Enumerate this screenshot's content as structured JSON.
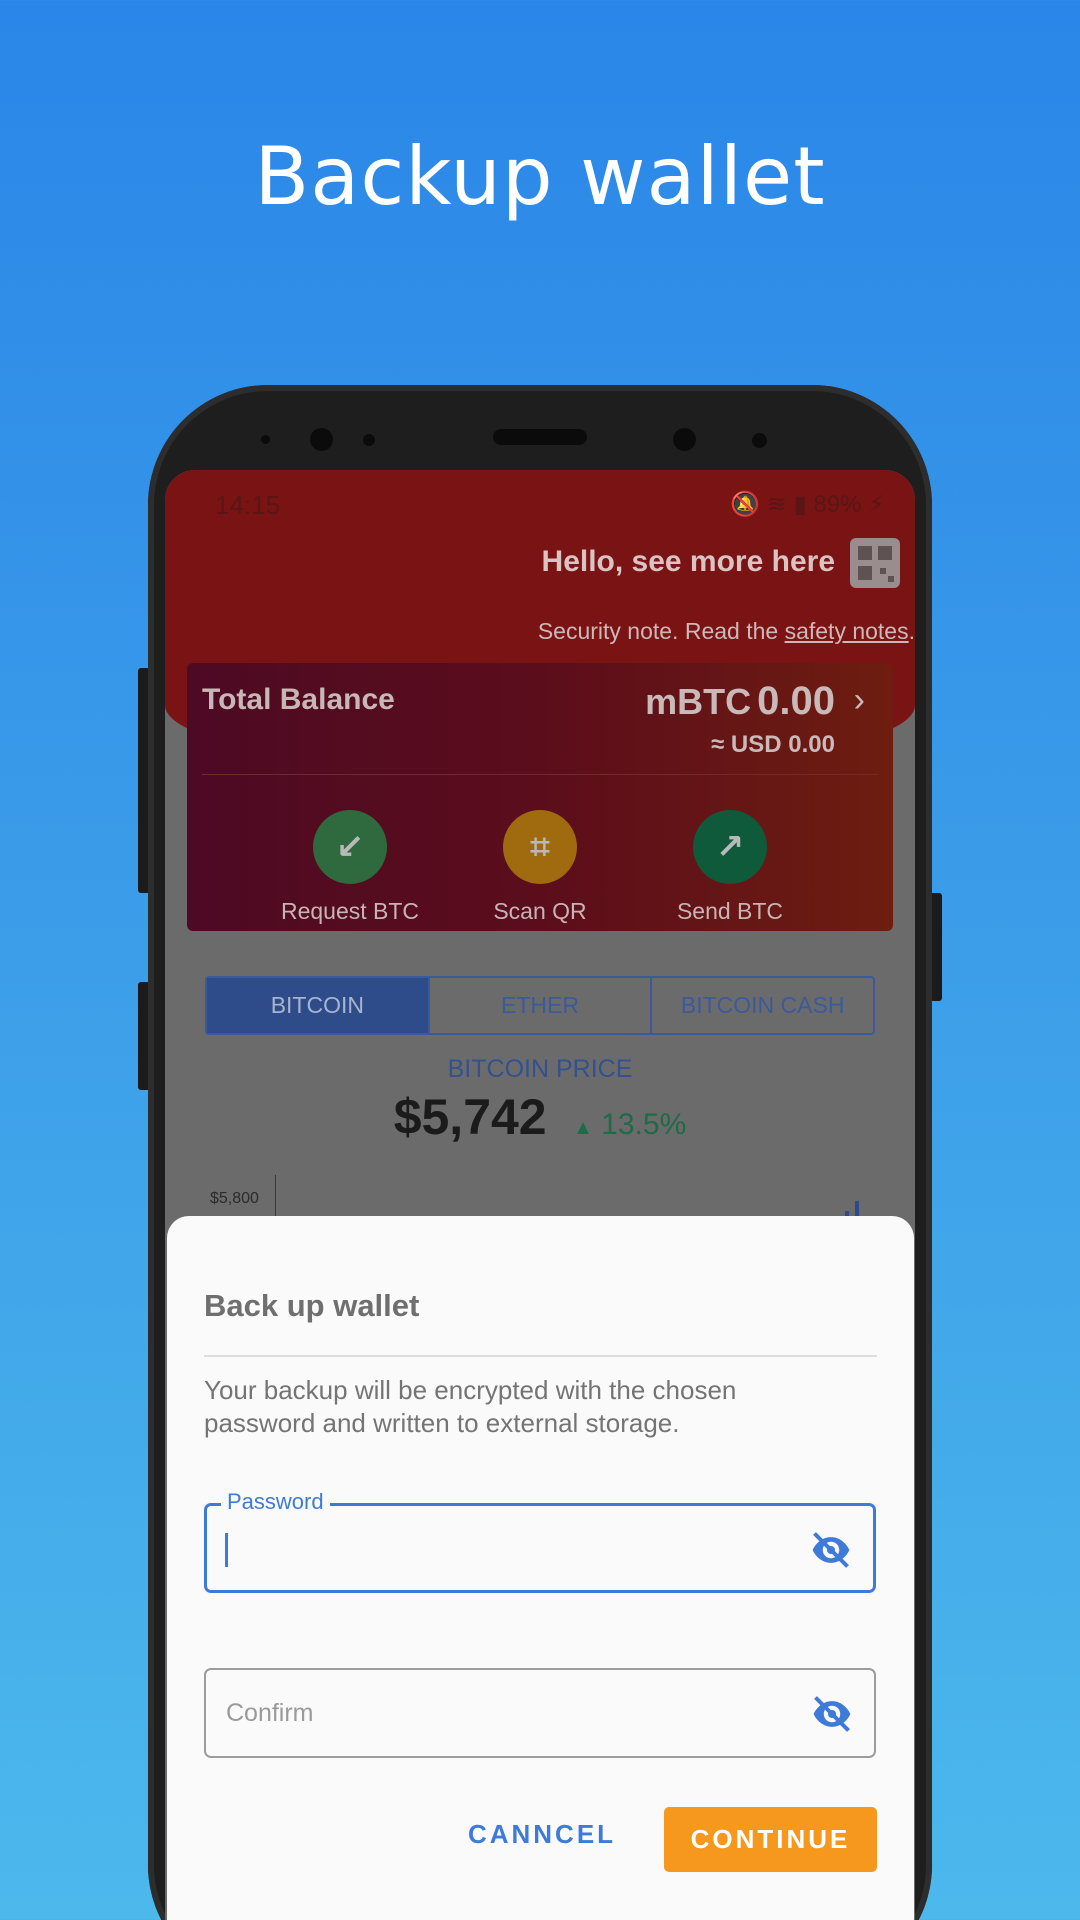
{
  "promo": {
    "title": "Backup wallet"
  },
  "status_bar": {
    "time": "14:15",
    "battery": "89%"
  },
  "header": {
    "greeting": "Hello, see more here",
    "security_prefix": "Security note. Read the ",
    "security_link": "safety notes",
    "security_suffix": "."
  },
  "balance": {
    "label": "Total Balance",
    "unit": "mBTC",
    "value": "0.00",
    "usd_prefix": "≈ USD",
    "usd_value": "0.00"
  },
  "actions": [
    {
      "label": "Request BTC",
      "icon": "arrow-down-left-icon",
      "color": "#2e6a3e"
    },
    {
      "label": "Scan QR",
      "icon": "qr-scan-icon",
      "color": "#a06a0e"
    },
    {
      "label": "Send BTC",
      "icon": "arrow-up-right-icon",
      "color": "#0e5a3b"
    }
  ],
  "tabs": [
    {
      "label": "BITCOIN",
      "active": true
    },
    {
      "label": "ETHER",
      "active": false
    },
    {
      "label": "BITCOIN CASH",
      "active": false
    }
  ],
  "price": {
    "label": "BITCOIN PRICE",
    "value": "$5,742",
    "change": "13.5%",
    "change_icon": "triangle-up-icon"
  },
  "chart": {
    "tick": "$5,800"
  },
  "dialog": {
    "title": "Back up wallet",
    "description": "Your backup will be encrypted with the chosen password and written to external storage.",
    "password_label": "Password",
    "confirm_placeholder": "Confirm",
    "cancel_label": "CANNCEL",
    "continue_label": "CONTINUE"
  },
  "colors": {
    "accent": "#3e7bd9",
    "continue": "#f6981d",
    "background_top": "#2a86e8",
    "background_bottom": "#4cb8ec"
  }
}
